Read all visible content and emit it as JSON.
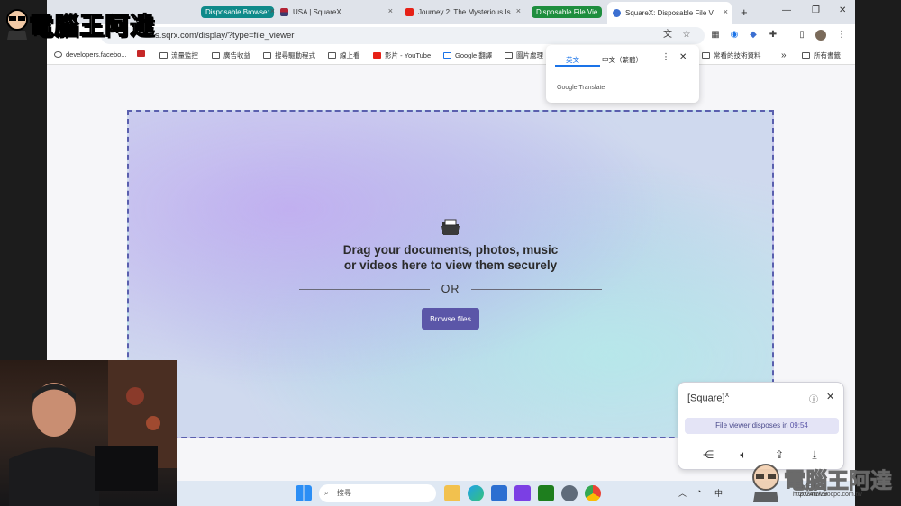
{
  "browser": {
    "tabs": [
      {
        "label": "Disposable Browser",
        "chip_color": "#0f8a8a"
      },
      {
        "label": "USA | SquareX"
      },
      {
        "label": "Journey 2: The Mysterious Is"
      },
      {
        "label": "Disposable File Vie",
        "chip_color": "#1e8e3e"
      },
      {
        "label": "SquareX: Disposable File V"
      }
    ],
    "new_tab": "+",
    "close_tab": "×",
    "url": "s.sqrx.com/display/?type=file_viewer",
    "bookmarks": [
      "developers.facebo...",
      "流量監控",
      "廣告收益",
      "搜尋驅動程式",
      "線上看",
      "影片 - YouTube",
      "Google 翻譯",
      "圖片處理",
      "常看的技術資料",
      "所有書籤"
    ],
    "more_bookmarks": "»"
  },
  "translate_popup": {
    "source_lang": "英文",
    "target_lang": "中文（繁體）",
    "brand": "Google Translate"
  },
  "viewer": {
    "drop_text_line1": "Drag your documents, photos, music",
    "drop_text_line2": "or videos here to view them securely",
    "or": "OR",
    "browse_label": "Browse files"
  },
  "panel": {
    "title": "[Square]",
    "title_sup": "X",
    "status_prefix": "File viewer disposes in",
    "countdown": "09:54",
    "icons": [
      "share-icon",
      "volume-icon",
      "upload-icon",
      "download-icon"
    ]
  },
  "taskbar": {
    "search_placeholder": "搜尋",
    "ime": "中",
    "date": "2024/1/29",
    "time": "下午 02:0"
  },
  "overlay": {
    "logo_text": "電腦王阿達",
    "watermark_text": "電腦王阿達",
    "watermark_url": "http://www.kocpc.com.tw"
  }
}
